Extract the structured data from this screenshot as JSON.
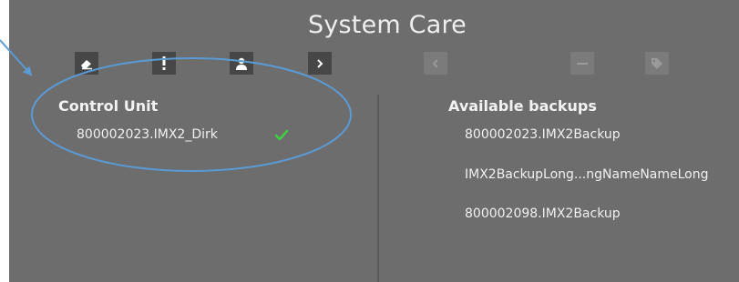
{
  "window": {
    "title": "System Care"
  },
  "toolbar": {
    "buttons": [
      {
        "icon": "eraser-icon",
        "enabled": true
      },
      {
        "icon": "exclamation-icon",
        "enabled": true
      },
      {
        "icon": "user-icon",
        "enabled": true
      },
      {
        "icon": "chevron-right-icon",
        "enabled": true
      },
      {
        "icon": "chevron-left-icon",
        "enabled": false
      },
      {
        "icon": "minus-icon",
        "enabled": false
      },
      {
        "icon": "tag-icon",
        "enabled": false
      }
    ]
  },
  "control_unit": {
    "heading": "Control Unit",
    "items": [
      {
        "label": "800002023.IMX2_Dirk",
        "status": "check-icon"
      }
    ]
  },
  "backups": {
    "heading": "Available backups",
    "items": [
      {
        "label": "800002023.IMX2Backup"
      },
      {
        "label": "IMX2BackupLong...ngNameNameLong"
      },
      {
        "label": "800002098.IMX2Backup"
      }
    ]
  },
  "annotation": {
    "color": "#5b9bd5"
  },
  "colors": {
    "panel": "#6d6d6d",
    "button": "#474747",
    "button_disabled": "#7b7b7b",
    "check": "#3fd13f"
  }
}
